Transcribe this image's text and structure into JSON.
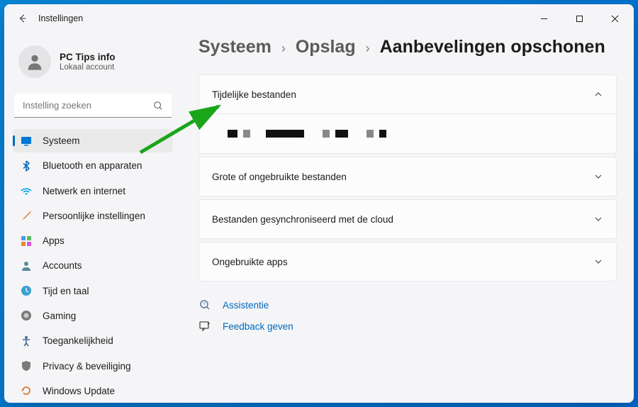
{
  "window": {
    "title": "Instellingen"
  },
  "profile": {
    "name": "PC Tips info",
    "subtitle": "Lokaal account"
  },
  "search": {
    "placeholder": "Instelling zoeken"
  },
  "nav": {
    "items": [
      {
        "label": "Systeem"
      },
      {
        "label": "Bluetooth en apparaten"
      },
      {
        "label": "Netwerk en internet"
      },
      {
        "label": "Persoonlijke instellingen"
      },
      {
        "label": "Apps"
      },
      {
        "label": "Accounts"
      },
      {
        "label": "Tijd en taal"
      },
      {
        "label": "Gaming"
      },
      {
        "label": "Toegankelijkheid"
      },
      {
        "label": "Privacy & beveiliging"
      },
      {
        "label": "Windows Update"
      }
    ]
  },
  "breadcrumb": {
    "root": "Systeem",
    "mid": "Opslag",
    "current": "Aanbevelingen opschonen"
  },
  "cards": {
    "temp": "Tijdelijke bestanden",
    "large": "Grote of ongebruikte bestanden",
    "cloud": "Bestanden gesynchroniseerd met de cloud",
    "unused": "Ongebruikte apps"
  },
  "footer": {
    "help": "Assistentie",
    "feedback": "Feedback geven"
  }
}
